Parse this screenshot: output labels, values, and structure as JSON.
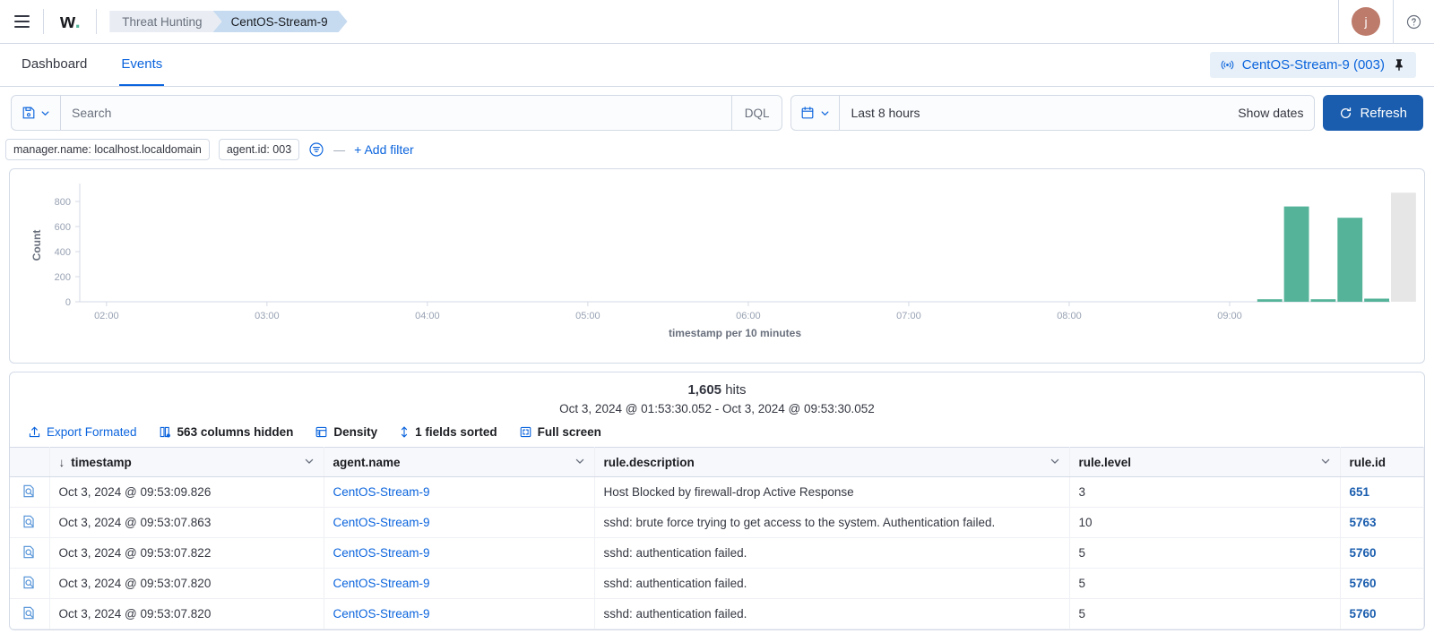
{
  "chrome": {
    "menu_icon": "hamburger-icon",
    "logo": "w",
    "logo_dot": ".",
    "breadcrumbs": [
      {
        "label": "Threat Hunting",
        "active": false
      },
      {
        "label": "CentOS-Stream-9",
        "active": true
      }
    ],
    "avatar_initial": "j",
    "help_icon": "question-circle-icon"
  },
  "tabs": [
    {
      "label": "Dashboard",
      "active": false
    },
    {
      "label": "Events",
      "active": true
    }
  ],
  "agent_badge": {
    "icon": "broadcast-icon",
    "label": "CentOS-Stream-9 (003)",
    "pin_icon": "pin-icon"
  },
  "search": {
    "saved_query_icon": "save-disk-icon",
    "placeholder": "Search",
    "value": "",
    "language": "DQL",
    "calendar_icon": "calendar-icon",
    "date_range": "Last 8 hours",
    "show_dates": "Show dates",
    "refresh_icon": "refresh-icon",
    "refresh_label": "Refresh"
  },
  "filters": {
    "pills": [
      "manager.name: localhost.localdomain",
      "agent.id: 003"
    ],
    "filter_icon": "filter-circle-icon",
    "separator": "—",
    "add_filter": "+ Add filter"
  },
  "results": {
    "hits_count": "1,605",
    "hits_label": "hits",
    "time_range": "Oct 3, 2024 @ 01:53:30.052 - Oct 3, 2024 @ 09:53:30.052",
    "toolbar": [
      {
        "label": "Export Formated",
        "icon": "export-icon",
        "style": "link"
      },
      {
        "label": "563 columns hidden",
        "icon": "columns-icon",
        "style": "strong"
      },
      {
        "label": "Density",
        "icon": "density-icon",
        "style": "strong"
      },
      {
        "label": "1 fields sorted",
        "icon": "sort-icon",
        "style": "strong"
      },
      {
        "label": "Full screen",
        "icon": "fullscreen-icon",
        "style": "strong"
      }
    ]
  },
  "table": {
    "columns": [
      {
        "label": "timestamp",
        "sorted": true,
        "sort_icon": "arrow-down-icon"
      },
      {
        "label": "agent.name",
        "sorted": false
      },
      {
        "label": "rule.description",
        "sorted": false
      },
      {
        "label": "rule.level",
        "sorted": false
      },
      {
        "label": "rule.id",
        "sorted": false
      }
    ],
    "expand_icon": "inspect-document-icon",
    "rows": [
      {
        "timestamp": "Oct 3, 2024 @ 09:53:09.826",
        "agent_name": "CentOS-Stream-9",
        "rule_description": "Host Blocked by firewall-drop Active Response",
        "rule_level": "3",
        "rule_id": "651"
      },
      {
        "timestamp": "Oct 3, 2024 @ 09:53:07.863",
        "agent_name": "CentOS-Stream-9",
        "rule_description": "sshd: brute force trying to get access to the system. Authentication failed.",
        "rule_level": "10",
        "rule_id": "5763"
      },
      {
        "timestamp": "Oct 3, 2024 @ 09:53:07.822",
        "agent_name": "CentOS-Stream-9",
        "rule_description": "sshd: authentication failed.",
        "rule_level": "5",
        "rule_id": "5760"
      },
      {
        "timestamp": "Oct 3, 2024 @ 09:53:07.820",
        "agent_name": "CentOS-Stream-9",
        "rule_description": "sshd: authentication failed.",
        "rule_level": "5",
        "rule_id": "5760"
      },
      {
        "timestamp": "Oct 3, 2024 @ 09:53:07.820",
        "agent_name": "CentOS-Stream-9",
        "rule_description": "sshd: authentication failed.",
        "rule_level": "5",
        "rule_id": "5760"
      }
    ]
  },
  "colors": {
    "bar": "#54b399",
    "partial_bar": "#e6e6e6",
    "accent": "#0b64dd",
    "primary_button": "#1a5dae",
    "avatar": "#bd7b6b"
  },
  "chart_data": {
    "type": "bar",
    "title": "",
    "xlabel": "timestamp per 10 minutes",
    "ylabel": "Count",
    "ylim": [
      0,
      900
    ],
    "yticks": [
      0,
      200,
      400,
      600,
      800
    ],
    "xticks": [
      "02:00",
      "03:00",
      "04:00",
      "05:00",
      "06:00",
      "07:00",
      "08:00",
      "09:00"
    ],
    "grid": false,
    "legend": null,
    "x": [
      "01:50",
      "02:00",
      "02:10",
      "02:20",
      "02:30",
      "02:40",
      "02:50",
      "03:00",
      "03:10",
      "03:20",
      "03:30",
      "03:40",
      "03:50",
      "04:00",
      "04:10",
      "04:20",
      "04:30",
      "04:40",
      "04:50",
      "05:00",
      "05:10",
      "05:20",
      "05:30",
      "05:40",
      "05:50",
      "06:00",
      "06:10",
      "06:20",
      "06:30",
      "06:40",
      "06:50",
      "07:00",
      "07:10",
      "07:20",
      "07:30",
      "07:40",
      "07:50",
      "08:00",
      "08:10",
      "08:20",
      "08:30",
      "08:40",
      "08:50",
      "09:00",
      "09:10",
      "09:20",
      "09:30",
      "09:40",
      "09:50"
    ],
    "values": [
      0,
      0,
      0,
      0,
      0,
      0,
      0,
      0,
      0,
      0,
      0,
      0,
      0,
      0,
      0,
      0,
      0,
      0,
      0,
      0,
      0,
      0,
      0,
      0,
      0,
      0,
      0,
      0,
      0,
      0,
      0,
      0,
      0,
      0,
      0,
      0,
      0,
      0,
      0,
      0,
      0,
      0,
      0,
      0,
      20,
      760,
      20,
      670,
      25
    ],
    "partial_last_bucket": {
      "index": 49,
      "value": 870,
      "color": "#e6e6e6",
      "note": "incomplete time bucket shown in grey"
    }
  }
}
